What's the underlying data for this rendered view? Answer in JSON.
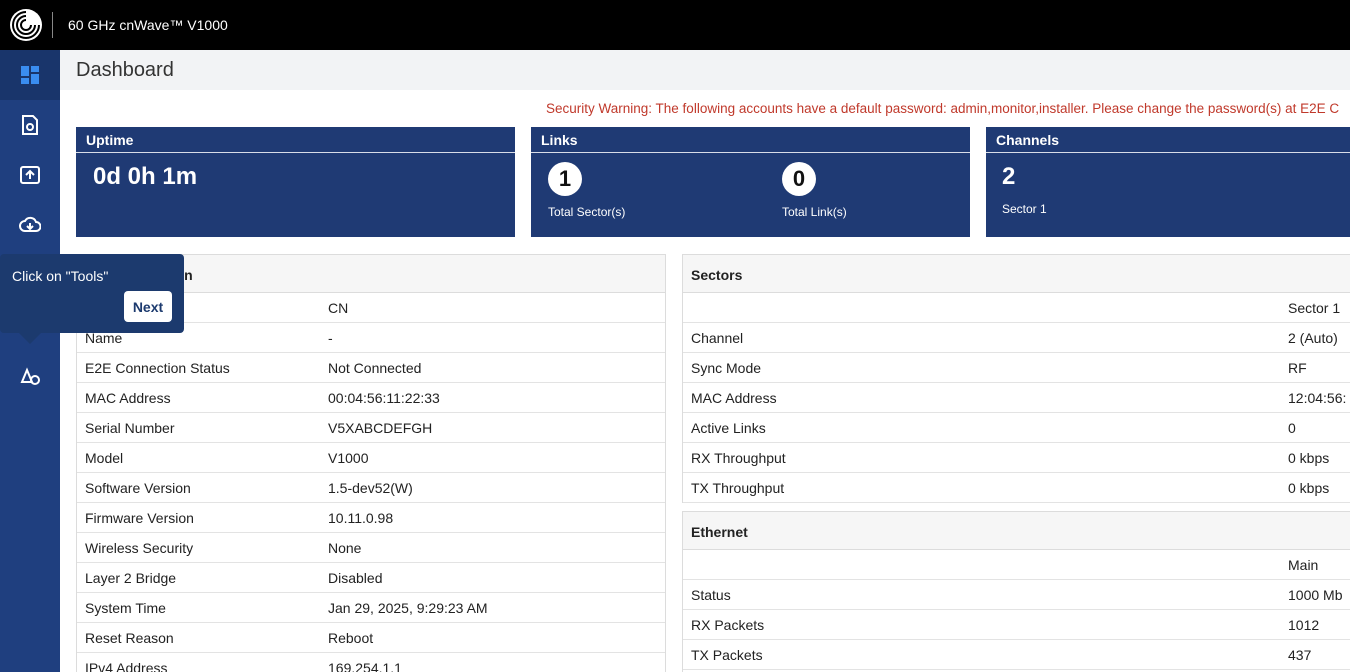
{
  "app": {
    "title": "60 GHz cnWave™ V1000"
  },
  "sidebar": {
    "items": [
      {
        "icon": "dashboard-icon",
        "active": true
      },
      {
        "icon": "configuration-icon"
      },
      {
        "icon": "upload-icon"
      },
      {
        "icon": "cloud-download-icon"
      },
      {
        "icon": "tools-icon"
      },
      {
        "icon": "monitor-icon"
      }
    ]
  },
  "page": {
    "title": "Dashboard"
  },
  "warning": "Security Warning: The following accounts have a default password: admin,monitor,installer. Please change the password(s) at E2E C",
  "cards": {
    "uptime": {
      "title": "Uptime",
      "value": "0d 0h 1m"
    },
    "links": {
      "title": "Links",
      "sectors_value": "1",
      "sectors_label": "Total Sector(s)",
      "links_value": "0",
      "links_label": "Total Link(s)"
    },
    "channels": {
      "title": "Channels",
      "value": "2",
      "label": "Sector 1"
    }
  },
  "device_info": {
    "title_partial": "tion",
    "rows": [
      {
        "k": "",
        "v": "CN"
      },
      {
        "k": "Name",
        "v": "-"
      },
      {
        "k": "E2E Connection Status",
        "v": "Not Connected"
      },
      {
        "k": "MAC Address",
        "v": "00:04:56:11:22:33"
      },
      {
        "k": "Serial Number",
        "v": "V5XABCDEFGH"
      },
      {
        "k": "Model",
        "v": "V1000"
      },
      {
        "k": "Software Version",
        "v": "1.5-dev52(W)"
      },
      {
        "k": "Firmware Version",
        "v": "10.11.0.98"
      },
      {
        "k": "Wireless Security",
        "v": "None"
      },
      {
        "k": "Layer 2 Bridge",
        "v": "Disabled"
      },
      {
        "k": "System Time",
        "v": "Jan 29, 2025, 9:29:23 AM"
      },
      {
        "k": "Reset Reason",
        "v": "Reboot"
      },
      {
        "k": "IPv4 Address",
        "v": "169.254.1.1"
      }
    ]
  },
  "sectors": {
    "title": "Sectors",
    "rows": [
      {
        "k": "",
        "v": "Sector 1"
      },
      {
        "k": "Channel",
        "v": "2 (Auto)"
      },
      {
        "k": "Sync Mode",
        "v": "RF"
      },
      {
        "k": "MAC Address",
        "v": "12:04:56:"
      },
      {
        "k": "Active Links",
        "v": "0"
      },
      {
        "k": "RX Throughput",
        "v": "0 kbps"
      },
      {
        "k": "TX Throughput",
        "v": "0 kbps"
      }
    ]
  },
  "ethernet": {
    "title": "Ethernet",
    "rows": [
      {
        "k": "",
        "v": "Main"
      },
      {
        "k": "Status",
        "v": "1000 Mb"
      },
      {
        "k": "RX Packets",
        "v": "1012"
      },
      {
        "k": "TX Packets",
        "v": "437"
      }
    ]
  },
  "tooltip": {
    "text": "Click on \"Tools\"",
    "button": "Next"
  }
}
